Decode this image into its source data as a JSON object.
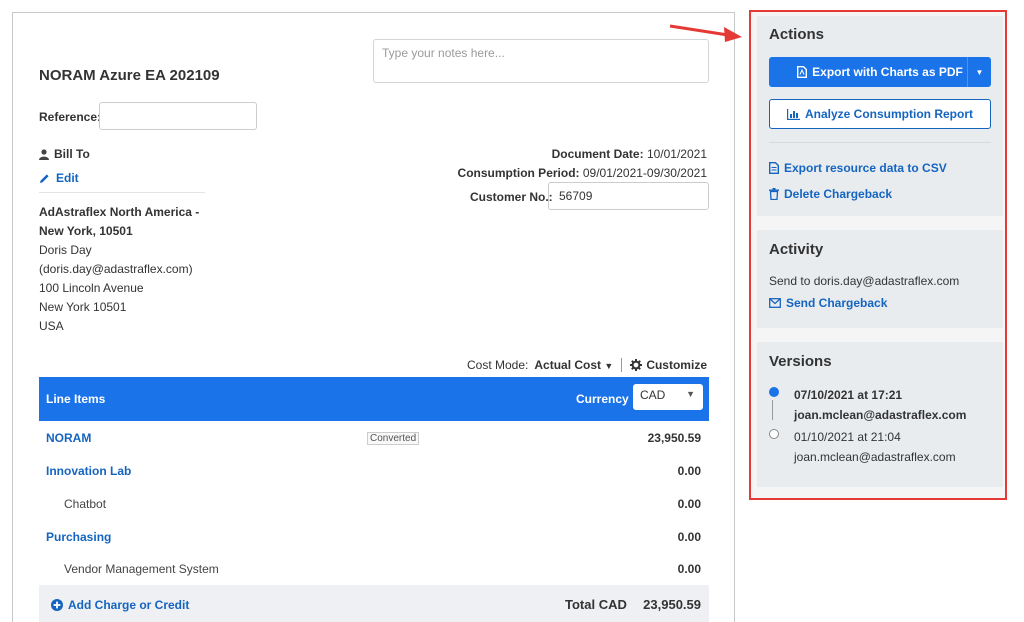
{
  "document": {
    "title": "NORAM Azure EA 202109",
    "notes_placeholder": "Type your notes here...",
    "reference_label": "Reference:",
    "reference_value": "",
    "bill_to_label": "Bill To",
    "edit_label": "Edit",
    "address": {
      "company": "AdAstraflex North America -",
      "company_line2": "New York, 10501",
      "contact": "Doris Day",
      "email": "(doris.day@adastraflex.com)",
      "street": "100 Lincoln Avenue",
      "city": "New York 10501",
      "country": "USA"
    },
    "document_date_label": "Document Date:",
    "document_date": "10/01/2021",
    "consumption_period_label": "Consumption Period:",
    "consumption_period": "09/01/2021-09/30/2021",
    "customer_no_label": "Customer No.:",
    "customer_no": "56709",
    "cost_mode_label": "Cost Mode:",
    "cost_mode_value": "Actual Cost",
    "customize_label": "Customize"
  },
  "line_items": {
    "header_label": "Line Items",
    "currency_label": "Currency",
    "currency_value": "CAD",
    "rows": [
      {
        "name": "NORAM",
        "badge": "Converted",
        "amount": "23,950.59"
      },
      {
        "name": "Innovation Lab",
        "amount": "0.00"
      },
      {
        "name": "Chatbot",
        "amount": "0.00"
      },
      {
        "name": "Purchasing",
        "amount": "0.00"
      },
      {
        "name": "Vendor Management System",
        "amount": "0.00"
      }
    ],
    "add_label": "Add Charge or Credit",
    "total_label": "Total CAD",
    "total_value": "23,950.59"
  },
  "sidebar": {
    "actions_title": "Actions",
    "export_pdf_label": "Export with Charts as PDF",
    "analyze_label": "Analyze Consumption Report",
    "export_csv_label": "Export resource data to CSV",
    "delete_label": "Delete Chargeback",
    "activity_title": "Activity",
    "activity_text": "Send to doris.day@adastraflex.com",
    "send_label": "Send Chargeback",
    "versions_title": "Versions",
    "versions": [
      {
        "date": "07/10/2021 at 17:21",
        "user": "joan.mclean@adastraflex.com"
      },
      {
        "date": "01/10/2021 at 21:04",
        "user": "joan.mclean@adastraflex.com"
      }
    ]
  },
  "colors": {
    "primary": "#1a73e8",
    "link": "#1565c0",
    "highlight": "#e53935"
  }
}
